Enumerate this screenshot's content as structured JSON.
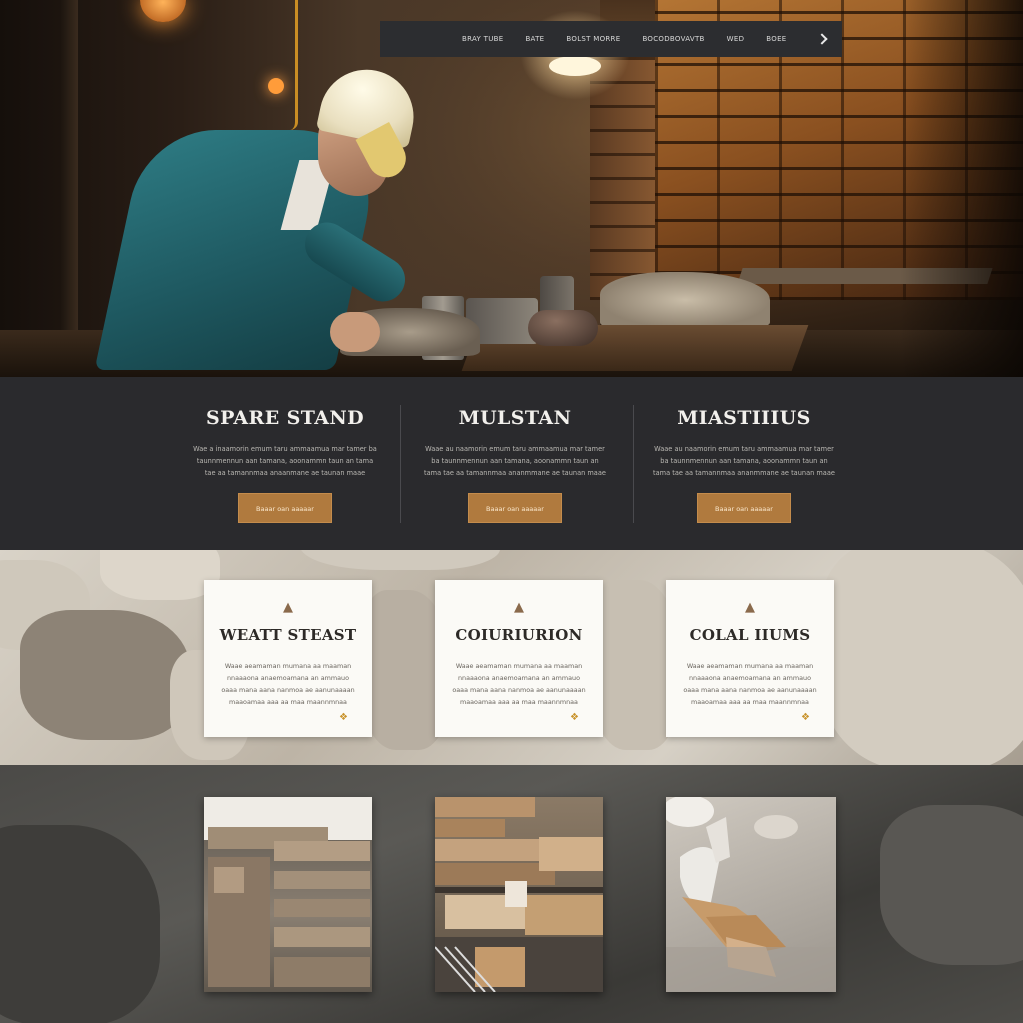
{
  "nav": {
    "items": [
      "BRAY TUBE",
      "BATE",
      "BOLST MORRE",
      "BOCODBOVAVTB",
      "WED",
      "BOEE"
    ],
    "next_icon": "chevron-right-icon"
  },
  "features": [
    {
      "title": "SPARE STAND",
      "body": "Wae a inaamorin emum taru ammaamua mar tamer ba taunnmennun aan tamana, aoonammn taun an tama tae aa tamannmaa anaanmane ae taunan maae",
      "button": "Baaar oan aaaaar"
    },
    {
      "title": "MULSTAN",
      "body": "Waae au naamorin emum taru ammaamua mar tamer ba taunnmennun aan tamana, aoonammn taun an tama tae aa tamannmaa ananmmane ae taunan maae",
      "button": "Baaar oan aaaaar"
    },
    {
      "title": "MIASTIIIUS",
      "body": "Waae au naamorin emum taru ammaamua mar tamer ba taunnmennun aan tamana, aoonammn taun an tama tae aa tamannmaa ananmmane ae taunan maae",
      "button": "Baaar oan aaaaar"
    }
  ],
  "cards": [
    {
      "title": "WEATT STEAST",
      "body": "Waae aeamaman mumana aa maaman nnaaaona anaemoamana an ammauo oaaa mana aana nanmoa ae aanunaaaan maaoamaa aaa aa maa maannmnaa",
      "icon": "trowel-icon",
      "corner_icon": "tool-icon"
    },
    {
      "title": "COIURIURION",
      "body": "Waae aeamaman mumana aa maaman nnaaaona anaemoamana an ammauo oaaa mana aana nanmoa ae aanunaaaan maaoamaa aaa aa maa maannmnaa",
      "icon": "trowel-icon",
      "corner_icon": "tool-icon"
    },
    {
      "title": "COLAL IIUMS",
      "body": "Waae aeamaman mumana aa maaman nnaaaona anaemoamana an ammauo oaaa mana aana nanmoa ae aanunaaaan maaoamaa aaa aa maa maannmnaa",
      "icon": "trowel-icon",
      "corner_icon": "tool-icon"
    }
  ],
  "gallery": [
    {
      "name": "stone-blocks-photo"
    },
    {
      "name": "timber-shelf-photo"
    },
    {
      "name": "plaster-tools-photo"
    }
  ],
  "colors": {
    "accent": "#b07a3e",
    "dark_band": "#2a2a2d",
    "card_bg": "#fbfaf6"
  }
}
